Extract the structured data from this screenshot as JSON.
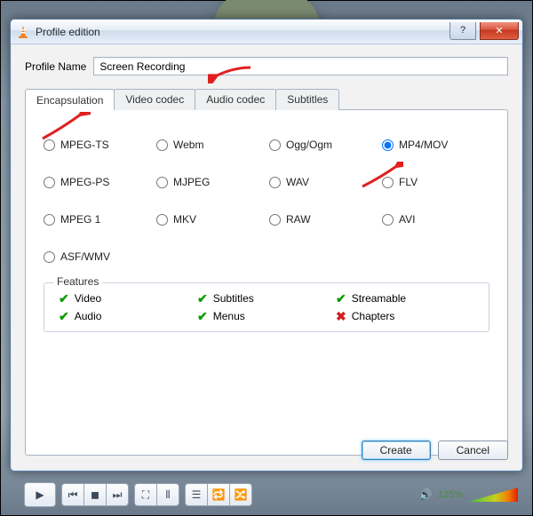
{
  "window": {
    "title": "Profile edition"
  },
  "profile": {
    "label": "Profile Name",
    "value": "Screen Recording"
  },
  "tabs": [
    {
      "label": "Encapsulation"
    },
    {
      "label": "Video codec"
    },
    {
      "label": "Audio codec"
    },
    {
      "label": "Subtitles"
    }
  ],
  "formats": [
    {
      "label": "MPEG-TS",
      "selected": false
    },
    {
      "label": "Webm",
      "selected": false
    },
    {
      "label": "Ogg/Ogm",
      "selected": false
    },
    {
      "label": "MP4/MOV",
      "selected": true
    },
    {
      "label": "MPEG-PS",
      "selected": false
    },
    {
      "label": "MJPEG",
      "selected": false
    },
    {
      "label": "WAV",
      "selected": false
    },
    {
      "label": "FLV",
      "selected": false
    },
    {
      "label": "MPEG 1",
      "selected": false
    },
    {
      "label": "MKV",
      "selected": false
    },
    {
      "label": "RAW",
      "selected": false
    },
    {
      "label": "AVI",
      "selected": false
    },
    {
      "label": "ASF/WMV",
      "selected": false
    }
  ],
  "features": {
    "legend": "Features",
    "items": [
      {
        "label": "Video",
        "ok": true
      },
      {
        "label": "Subtitles",
        "ok": true
      },
      {
        "label": "Streamable",
        "ok": true
      },
      {
        "label": "Audio",
        "ok": true
      },
      {
        "label": "Menus",
        "ok": true
      },
      {
        "label": "Chapters",
        "ok": false
      }
    ]
  },
  "buttons": {
    "create": "Create",
    "cancel": "Cancel"
  },
  "player": {
    "volume_label": "125%"
  }
}
